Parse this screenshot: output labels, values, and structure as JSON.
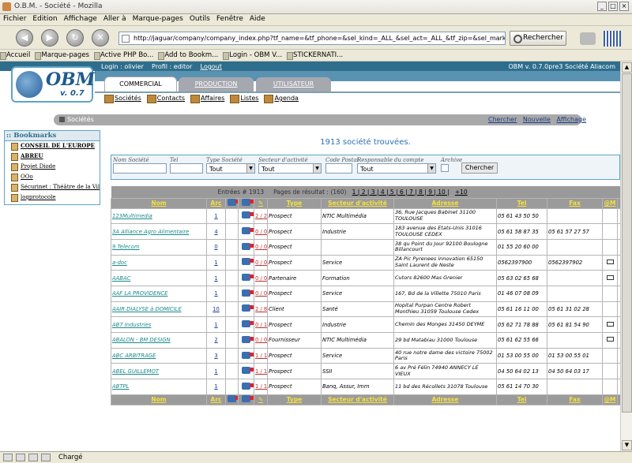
{
  "window": {
    "title": "O.B.M. - Société - Mozilla"
  },
  "menu": [
    "Fichier",
    "Edition",
    "Affichage",
    "Aller à",
    "Marque-pages",
    "Outils",
    "Fenêtre",
    "Aide"
  ],
  "nav": {
    "url": "http://jaguar/company/company_index.php?tf_name=&tf_phone=&sel_kind=_ALL_&sel_act=_ALL_&tf_zip=&sel_market=_ALL_&action",
    "search_label": "Rechercher"
  },
  "bookmark_bar": [
    "Accueil",
    "Marque-pages",
    "Active PHP Bo...",
    "Add to Bookm...",
    "Login - OBM V...",
    "STICKERNATI..."
  ],
  "header": {
    "login": "Login : olivier",
    "profile": "Profil : editor",
    "logout": "Logout",
    "version": "OBM v. 0.7.0pre3   Société Aliacom",
    "logo": "OBM",
    "logo_version": "v. 0.7"
  },
  "tabs": {
    "commercial": "COMMERCIAL",
    "production": "PRODUCTION",
    "utilisateur": "UTILISATEUR"
  },
  "subnav": [
    "Sociétés",
    "Contacts",
    "Affaires",
    "Listes",
    "Agenda"
  ],
  "section": {
    "label": "Sociétés",
    "links": [
      "Chercher",
      "Nouvelle",
      "Affichage"
    ]
  },
  "bookmarks": {
    "title": ":: Bookmarks",
    "items": [
      "CONSEIL DE L'EUROPE",
      "ABREU",
      "Projet Diode",
      "OOo",
      "Sécurinet : Théâtre de la Vill",
      "logprotocole"
    ]
  },
  "search": {
    "found": "1913 société trouvées.",
    "labels": {
      "name": "Nom Société",
      "tel": "Tel",
      "type": "Type Société",
      "sector": "Secteur d'activité",
      "zip": "Code Postal",
      "resp": "Responsable du compte",
      "archive": "Archive"
    },
    "type_value": "Tout",
    "sector_value": "Tout",
    "resp_value": "Tout",
    "button": "Chercher"
  },
  "pagination": {
    "entries": "Entrées # 1913",
    "pages": "Pages de résultat : (160)",
    "links": "1 | 2 | 3 | 4 | 5 | 6 | 7 | 8 | 9 | 10 |",
    "next": "+10"
  },
  "columns": {
    "nom": "Nom",
    "arc": "Arc",
    "type": "Type",
    "secteur": "Secteur d'activité",
    "adresse": "Adresse",
    "tel": "Tel",
    "fax": "Fax",
    "mail": "@M",
    "web": "W"
  },
  "rows": [
    {
      "nom": "123Multimedia",
      "arc": "1",
      "deals": "2 / 2",
      "type": "Prospect",
      "secteur": "NTIC Multimédia",
      "adresse": "36, Rue Jacques Babinet 31100 TOULOUSE",
      "tel": "05 61 43 50 50",
      "fax": "",
      "mail": false,
      "web": false
    },
    {
      "nom": "3A Alliance Agro Alimentaire",
      "arc": "4",
      "deals": "0 / 0",
      "type": "Prospect",
      "secteur": "Industrie",
      "adresse": "183 avenue des Etats-Unis 31016 TOULOUSE CEDEX",
      "tel": "05 61 58 87 35",
      "fax": "05 61 57 27 57",
      "mail": false,
      "web": false
    },
    {
      "nom": "9 Telecom",
      "arc": "0",
      "deals": "0 / 0",
      "type": "Prospect",
      "secteur": "",
      "adresse": "38 qu Point du Jour 92100 Boulogne Billancourt",
      "tel": "01 55 20 60 00",
      "fax": "",
      "mail": false,
      "web": false
    },
    {
      "nom": "a-doc",
      "arc": "1",
      "deals": "0 / 0",
      "type": "Prospect",
      "secteur": "Service",
      "adresse": "ZA Pic Pyrenees innovation 65150 Saint Laurent de Neste",
      "tel": "0562397900",
      "fax": "0562397902",
      "mail": true,
      "web": false
    },
    {
      "nom": "AABAC",
      "arc": "1",
      "deals": "0 / 0",
      "type": "Partenaire",
      "secteur": "Formation",
      "adresse": "Cutors 82600 Mas Grenier",
      "tel": "05 63 02 65 68",
      "fax": "",
      "mail": true,
      "web": false
    },
    {
      "nom": "AAF LA PROVIDENCE",
      "arc": "1",
      "deals": "0 / 0",
      "type": "Prospect",
      "secteur": "Service",
      "adresse": "167, Bd de la Villette 75010 Paris",
      "tel": "01 46 07 08 09",
      "fax": "",
      "mail": false,
      "web": false
    },
    {
      "nom": "AAIR DIALYSE à DOMICILE",
      "arc": "10",
      "deals": "2 / 8",
      "type": "Client",
      "secteur": "Santé",
      "adresse": "Hopital Purpan Centre Robert Monthieu 31059 Toulouse Cedex",
      "tel": "05 61 16 11 00",
      "fax": "05 61 31 02 28",
      "mail": false,
      "web": false
    },
    {
      "nom": "AB7 Industries",
      "arc": "1",
      "deals": "0 / 1",
      "type": "Prospect",
      "secteur": "Industrie",
      "adresse": "Chemin des Monges 31450 DEYME",
      "tel": "05 62 71 78 88",
      "fax": "05 61 81 54 90",
      "mail": true,
      "web": true
    },
    {
      "nom": "ABALON - BM DESIGN",
      "arc": "2",
      "deals": "0 / 0",
      "type": "Fournisseur",
      "secteur": "NTIC Multimédia",
      "adresse": "29 bd Matabiau 31000 Toulouse",
      "tel": "05 61 62 55 66",
      "fax": "",
      "mail": true,
      "web": false
    },
    {
      "nom": "ABC ARBITRAGE",
      "arc": "3",
      "deals": "1 / 1",
      "type": "Prospect",
      "secteur": "Service",
      "adresse": "40 rue notre dame des victoire 75002 Paris",
      "tel": "01 53 00 55 00",
      "fax": "01 53 00 55 01",
      "mail": false,
      "web": false
    },
    {
      "nom": "ABEL GUILLEMOT",
      "arc": "1",
      "deals": "1 / 1",
      "type": "Prospect",
      "secteur": "SSII",
      "adresse": "6 av Pré Félin 74940 ANNECY LE VIEUX",
      "tel": "04 50 64 02 13",
      "fax": "04 50 64 03 17",
      "mail": false,
      "web": false
    },
    {
      "nom": "ABTPL",
      "arc": "1",
      "deals": "1 / 1",
      "type": "Prospect",
      "secteur": "Banq, Assur, Imm",
      "adresse": "11 bd des Récollets 31078 Toulouse",
      "tel": "05 61 14 70 30",
      "fax": "",
      "mail": false,
      "web": false
    }
  ],
  "status": "Chargé"
}
